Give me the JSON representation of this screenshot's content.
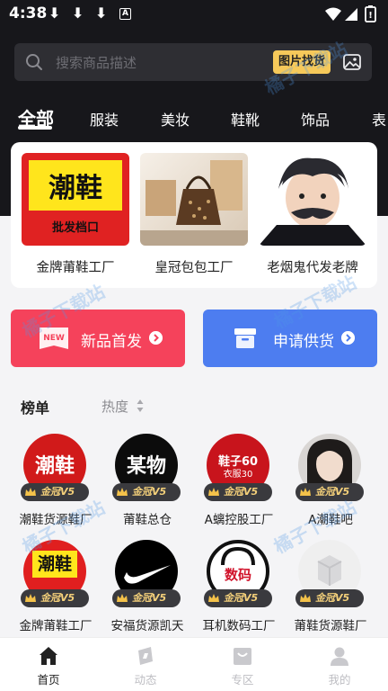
{
  "status_bar": {
    "time": "4:38",
    "download_glyph": "⬇",
    "a_label": "A"
  },
  "search": {
    "placeholder": "搜索商品描述",
    "image_search_label": "图片找货"
  },
  "categories": [
    {
      "label": "全部",
      "active": true
    },
    {
      "label": "服装"
    },
    {
      "label": "美妆"
    },
    {
      "label": "鞋靴"
    },
    {
      "label": "饰品"
    },
    {
      "label": "表"
    }
  ],
  "featured": [
    {
      "label": "金牌莆鞋工厂",
      "logo_text": "潮鞋",
      "logo_sub": "批发档口"
    },
    {
      "label": "皇冠包包工厂"
    },
    {
      "label": "老烟鬼代发老牌"
    }
  ],
  "actions": {
    "new_label": "新品首发",
    "new_badge": "NEW",
    "supply_label": "申请供货"
  },
  "ranking": {
    "title": "榜单",
    "sort_label": "热度",
    "badge_text": "金冠V5",
    "shops": [
      {
        "name": "潮鞋货源鞋厂",
        "logo_text": "潮鞋"
      },
      {
        "name": "莆鞋总仓",
        "logo_text": "某物"
      },
      {
        "name": "A螭控股工厂",
        "logo_text": "鞋子60",
        "logo_sub": "衣服30"
      },
      {
        "name": "A潮鞋吧"
      },
      {
        "name": "金牌莆鞋工厂",
        "logo_text": "潮鞋"
      },
      {
        "name": "安福货源凯天"
      },
      {
        "name": "耳机数码工厂",
        "logo_text": "数码"
      },
      {
        "name": "莆鞋货源鞋厂"
      }
    ]
  },
  "bottom_nav": [
    {
      "label": "首页",
      "icon": "home-icon",
      "active": true
    },
    {
      "label": "动态",
      "icon": "compass-icon"
    },
    {
      "label": "专区",
      "icon": "shop-icon"
    },
    {
      "label": "我的",
      "icon": "user-icon"
    }
  ],
  "watermark": "橘子下载站",
  "colors": {
    "header_bg": "#17171b",
    "new_btn": "#f5425b",
    "supply_btn": "#4d7df0",
    "badge_gold": "#f4d07a",
    "image_search_btn": "#f6c95a"
  }
}
